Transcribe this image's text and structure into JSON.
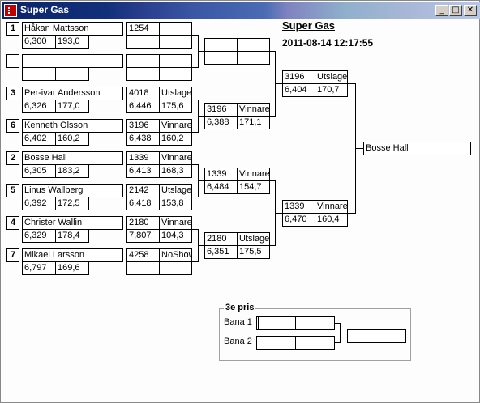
{
  "window": {
    "title": "Super Gas",
    "controls": [
      "minimize",
      "maximize",
      "close"
    ]
  },
  "header": {
    "event_title": "Super Gas",
    "datetime": "2011-08-14 12:17:55"
  },
  "round1": [
    {
      "seed": "1",
      "name": "Håkan Mattsson",
      "rt": "6,300",
      "speed": "193,0",
      "time": "1254",
      "status": "",
      "r2": "",
      "r3": ""
    },
    {
      "seed": "",
      "name": "",
      "rt": "",
      "speed": "",
      "time": "",
      "status": "",
      "r2": "",
      "r3": ""
    },
    {
      "seed": "3",
      "name": "Per-ivar Andersson",
      "rt": "6,326",
      "speed": "177,0",
      "time": "4018",
      "status": "Utslagen",
      "r2": "6,446",
      "r3": "175,6"
    },
    {
      "seed": "6",
      "name": "Kenneth Olsson",
      "rt": "6,402",
      "speed": "160,2",
      "time": "3196",
      "status": "Vinnare",
      "r2": "6,438",
      "r3": "160,2"
    },
    {
      "seed": "2",
      "name": "Bosse Hall",
      "rt": "6,305",
      "speed": "183,2",
      "time": "1339",
      "status": "Vinnare",
      "r2": "6,413",
      "r3": "168,3"
    },
    {
      "seed": "5",
      "name": "Linus Wallberg",
      "rt": "6,392",
      "speed": "172,5",
      "time": "2142",
      "status": "Utslagen",
      "r2": "6,418",
      "r3": "153,8"
    },
    {
      "seed": "4",
      "name": "Christer Wallin",
      "rt": "6,329",
      "speed": "178,4",
      "time": "2180",
      "status": "Vinnare",
      "r2": "7,807",
      "r3": "104,3"
    },
    {
      "seed": "7",
      "name": "Mikael Larsson",
      "rt": "6,797",
      "speed": "169,6",
      "time": "4258",
      "status": "NoShow",
      "r2": "",
      "r3": ""
    }
  ],
  "quarterfinals": [
    {
      "time": "",
      "status": "",
      "et": "",
      "speed": ""
    },
    {
      "time": "3196",
      "status": "Vinnare",
      "et": "6,388",
      "speed": "171,1"
    },
    {
      "time": "1339",
      "status": "Vinnare",
      "et": "6,484",
      "speed": "154,7"
    },
    {
      "time": "2180",
      "status": "Utslagen",
      "et": "6,351",
      "speed": "175,5"
    }
  ],
  "semifinals": [
    {
      "time": "3196",
      "status": "Utslagen",
      "et": "6,404",
      "speed": "170,7"
    },
    {
      "time": "1339",
      "status": "Vinnare",
      "et": "6,470",
      "speed": "160,4"
    }
  ],
  "winner": {
    "name": "Bosse Hall"
  },
  "third_place": {
    "title": "3e pris",
    "lane1_label": "Bana 1",
    "lane2_label": "Bana 2"
  }
}
